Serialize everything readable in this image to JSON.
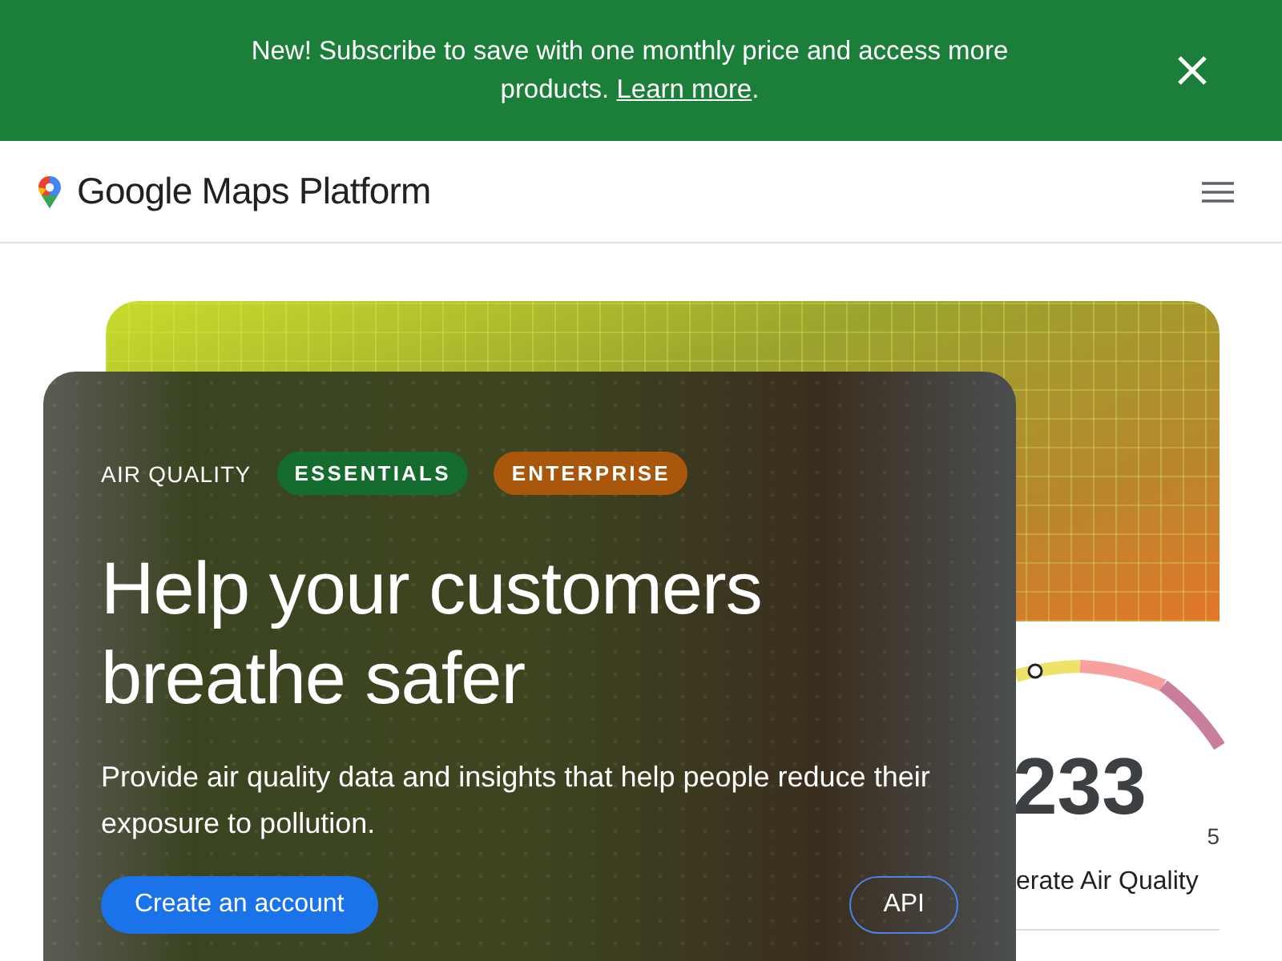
{
  "banner": {
    "text_before": "New! Subscribe to save with one monthly price and access more products. ",
    "link": "Learn more",
    "text_after": "."
  },
  "header": {
    "logo_text": "Google Maps Platform"
  },
  "hero": {
    "eyebrow": "AIR QUALITY",
    "tags": [
      {
        "label": "ESSENTIALS",
        "color": "#146c2e"
      },
      {
        "label": "ENTERPRISE",
        "color": "#a8570c"
      }
    ],
    "heading": "Help your customers breathe safer",
    "description": "Provide air quality data and insights that help people reduce their exposure to pollution.",
    "buttons": [
      {
        "label": "Create an account",
        "kind": "primary"
      },
      {
        "label": "API",
        "kind": "outline"
      }
    ]
  },
  "gauge": {
    "value": "233",
    "scale_label": "5",
    "label": "erate Air Quality"
  }
}
